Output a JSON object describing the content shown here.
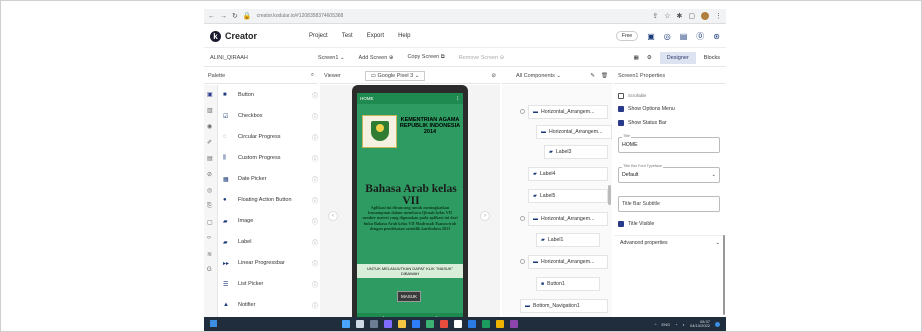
{
  "browser": {
    "url": "creator.kodular.io/#1208358374605368"
  },
  "app": {
    "name": "Creator",
    "menu": [
      "Project",
      "Test",
      "Export",
      "Help"
    ],
    "plan": "Free"
  },
  "toolbar": {
    "project_name": "ALINI_QIRAAH",
    "screen_select": "Screen1",
    "add_screen": "Add Screen",
    "copy_screen": "Copy Screen",
    "remove_screen": "Remove Screen",
    "designer": "Designer",
    "blocks": "Blocks"
  },
  "panels": {
    "palette": "Palette",
    "viewer": "Viewer",
    "device": "Google Pixel 3",
    "components": "All Components",
    "properties": "Screen1 Properties"
  },
  "palette": {
    "items": [
      {
        "label": "Button",
        "icon": "button-icon"
      },
      {
        "label": "Checkbox",
        "icon": "checkbox-icon"
      },
      {
        "label": "Circular Progress",
        "icon": "circular-progress-icon"
      },
      {
        "label": "Custom Progress",
        "icon": "custom-progress-icon"
      },
      {
        "label": "Date Picker",
        "icon": "calendar-icon"
      },
      {
        "label": "Floating Action Button",
        "icon": "fab-icon"
      },
      {
        "label": "Image",
        "icon": "image-icon"
      },
      {
        "label": "Label",
        "icon": "label-icon"
      },
      {
        "label": "Linear Progressbar",
        "icon": "linear-progress-icon"
      },
      {
        "label": "List Picker",
        "icon": "list-icon"
      },
      {
        "label": "Notifier",
        "icon": "notifier-icon"
      }
    ]
  },
  "phone": {
    "header": "HOME",
    "kementrian": "KEMENTRIAN AGAMA REPUBLIK INDONESIA 2014",
    "title": "Bahasa Arab kelas VII",
    "description": "Aplikasi ini dirancang untuk meningkatkan kemampuan dalam membaca Qiraah kelas VII sumber materi yang digunakan pada aplikasi ini dari buku Bahasa Arab kelas VII Madrasah Tsanawiyah dengan pendekatan saintifik kurikulum 2013",
    "notice": "UNTUK MELANJUTKAN DAPAT KLIK \"MASUK\" DIBAWAH",
    "button": "MASUK"
  },
  "components": [
    "Horizontal_Arrangem...",
    "Horizontal_Arrangem...",
    "Label3",
    "Label4",
    "Label5",
    "Horizontal_Arrangem...",
    "Label1",
    "Horizontal_Arrangem...",
    "Button1",
    "Bottom_Navigation1"
  ],
  "properties": {
    "scrollable": "Scrollable",
    "show_options_menu": "Show Options Menu",
    "show_status_bar": "Show Status Bar",
    "title_label": "Title",
    "title_value": "HOME",
    "typeface_label": "Title Bar Font Typeface",
    "typeface_value": "Default",
    "subtitle_placeholder": "Title Bar Subtitle",
    "title_visible": "Title Visible",
    "advanced": "Advanced properties"
  },
  "taskbar": {
    "lang": "ENG",
    "time": "08:37",
    "date": "04/10/2022"
  },
  "colors": {
    "accent": "#2a3a8a",
    "phone_green": "#2e9c62",
    "taskbar": "#1f2d3d"
  }
}
